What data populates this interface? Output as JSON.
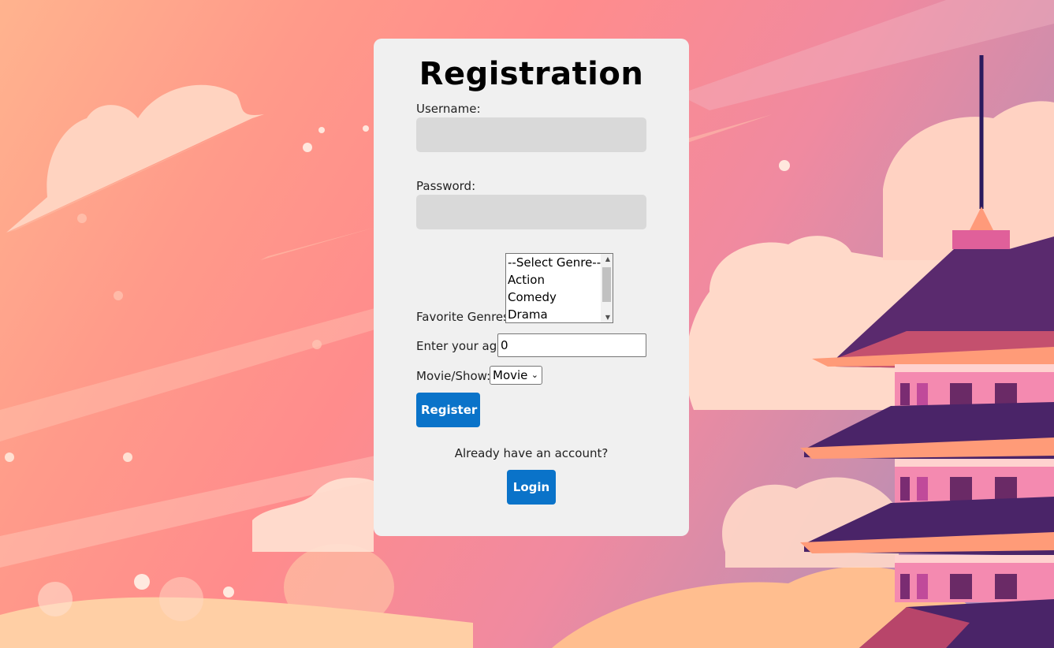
{
  "form": {
    "title": "Registration",
    "username_label": "Username:",
    "username_value": "",
    "password_label": "Password:",
    "password_value": "",
    "genres_label": "Favorite Genres:",
    "genre_options": [
      "--Select Genre--",
      "Action",
      "Comedy",
      "Drama"
    ],
    "age_label": "Enter your age",
    "age_value": "0",
    "type_label": "Movie/Show:",
    "type_selected": "Movie",
    "register_label": "Register",
    "account_prompt": "Already have an account?",
    "login_label": "Login"
  },
  "colors": {
    "button": "#0a73c9",
    "card": "#f0f0f0",
    "field": "#d9d9d9"
  },
  "icons": {
    "select_chevron": "chevron-down-icon",
    "scroll_up": "scroll-up-arrow-icon",
    "scroll_down": "scroll-down-arrow-icon"
  }
}
